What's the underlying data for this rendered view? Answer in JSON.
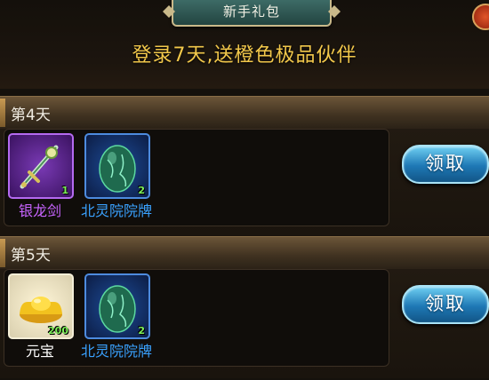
{
  "header": {
    "title": "新手礼包",
    "promo": "登录7天,送橙色极品伙伴"
  },
  "days": [
    {
      "label": "第4天",
      "claim_label": "领取",
      "rewards": [
        {
          "name": "银龙剑",
          "count": "1",
          "rarity_color": "#c864ff",
          "icon": "silver-dragon-sword-icon"
        },
        {
          "name": "北灵院院牌",
          "count": "2",
          "rarity_color": "#3aa2ff",
          "icon": "jade-egg-token-icon"
        }
      ]
    },
    {
      "label": "第5天",
      "claim_label": "领取",
      "rewards": [
        {
          "name": "元宝",
          "count": "200",
          "rarity_color": "#ffffff",
          "icon": "gold-ingot-icon"
        },
        {
          "name": "北灵院院牌",
          "count": "2",
          "rarity_color": "#3aa2ff",
          "icon": "jade-egg-token-icon"
        }
      ]
    }
  ]
}
